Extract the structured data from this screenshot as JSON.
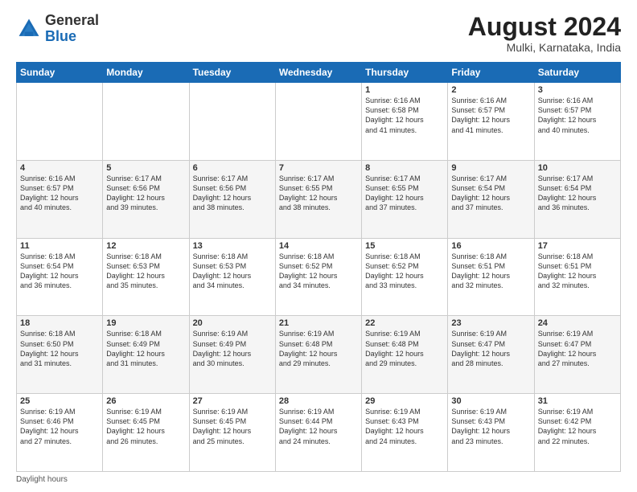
{
  "header": {
    "logo_general": "General",
    "logo_blue": "Blue",
    "title": "August 2024",
    "subtitle": "Mulki, Karnataka, India"
  },
  "days_of_week": [
    "Sunday",
    "Monday",
    "Tuesday",
    "Wednesday",
    "Thursday",
    "Friday",
    "Saturday"
  ],
  "weeks": [
    [
      {
        "day": "",
        "info": ""
      },
      {
        "day": "",
        "info": ""
      },
      {
        "day": "",
        "info": ""
      },
      {
        "day": "",
        "info": ""
      },
      {
        "day": "1",
        "info": "Sunrise: 6:16 AM\nSunset: 6:58 PM\nDaylight: 12 hours\nand 41 minutes."
      },
      {
        "day": "2",
        "info": "Sunrise: 6:16 AM\nSunset: 6:57 PM\nDaylight: 12 hours\nand 41 minutes."
      },
      {
        "day": "3",
        "info": "Sunrise: 6:16 AM\nSunset: 6:57 PM\nDaylight: 12 hours\nand 40 minutes."
      }
    ],
    [
      {
        "day": "4",
        "info": "Sunrise: 6:16 AM\nSunset: 6:57 PM\nDaylight: 12 hours\nand 40 minutes."
      },
      {
        "day": "5",
        "info": "Sunrise: 6:17 AM\nSunset: 6:56 PM\nDaylight: 12 hours\nand 39 minutes."
      },
      {
        "day": "6",
        "info": "Sunrise: 6:17 AM\nSunset: 6:56 PM\nDaylight: 12 hours\nand 38 minutes."
      },
      {
        "day": "7",
        "info": "Sunrise: 6:17 AM\nSunset: 6:55 PM\nDaylight: 12 hours\nand 38 minutes."
      },
      {
        "day": "8",
        "info": "Sunrise: 6:17 AM\nSunset: 6:55 PM\nDaylight: 12 hours\nand 37 minutes."
      },
      {
        "day": "9",
        "info": "Sunrise: 6:17 AM\nSunset: 6:54 PM\nDaylight: 12 hours\nand 37 minutes."
      },
      {
        "day": "10",
        "info": "Sunrise: 6:17 AM\nSunset: 6:54 PM\nDaylight: 12 hours\nand 36 minutes."
      }
    ],
    [
      {
        "day": "11",
        "info": "Sunrise: 6:18 AM\nSunset: 6:54 PM\nDaylight: 12 hours\nand 36 minutes."
      },
      {
        "day": "12",
        "info": "Sunrise: 6:18 AM\nSunset: 6:53 PM\nDaylight: 12 hours\nand 35 minutes."
      },
      {
        "day": "13",
        "info": "Sunrise: 6:18 AM\nSunset: 6:53 PM\nDaylight: 12 hours\nand 34 minutes."
      },
      {
        "day": "14",
        "info": "Sunrise: 6:18 AM\nSunset: 6:52 PM\nDaylight: 12 hours\nand 34 minutes."
      },
      {
        "day": "15",
        "info": "Sunrise: 6:18 AM\nSunset: 6:52 PM\nDaylight: 12 hours\nand 33 minutes."
      },
      {
        "day": "16",
        "info": "Sunrise: 6:18 AM\nSunset: 6:51 PM\nDaylight: 12 hours\nand 32 minutes."
      },
      {
        "day": "17",
        "info": "Sunrise: 6:18 AM\nSunset: 6:51 PM\nDaylight: 12 hours\nand 32 minutes."
      }
    ],
    [
      {
        "day": "18",
        "info": "Sunrise: 6:18 AM\nSunset: 6:50 PM\nDaylight: 12 hours\nand 31 minutes."
      },
      {
        "day": "19",
        "info": "Sunrise: 6:18 AM\nSunset: 6:49 PM\nDaylight: 12 hours\nand 31 minutes."
      },
      {
        "day": "20",
        "info": "Sunrise: 6:19 AM\nSunset: 6:49 PM\nDaylight: 12 hours\nand 30 minutes."
      },
      {
        "day": "21",
        "info": "Sunrise: 6:19 AM\nSunset: 6:48 PM\nDaylight: 12 hours\nand 29 minutes."
      },
      {
        "day": "22",
        "info": "Sunrise: 6:19 AM\nSunset: 6:48 PM\nDaylight: 12 hours\nand 29 minutes."
      },
      {
        "day": "23",
        "info": "Sunrise: 6:19 AM\nSunset: 6:47 PM\nDaylight: 12 hours\nand 28 minutes."
      },
      {
        "day": "24",
        "info": "Sunrise: 6:19 AM\nSunset: 6:47 PM\nDaylight: 12 hours\nand 27 minutes."
      }
    ],
    [
      {
        "day": "25",
        "info": "Sunrise: 6:19 AM\nSunset: 6:46 PM\nDaylight: 12 hours\nand 27 minutes."
      },
      {
        "day": "26",
        "info": "Sunrise: 6:19 AM\nSunset: 6:45 PM\nDaylight: 12 hours\nand 26 minutes."
      },
      {
        "day": "27",
        "info": "Sunrise: 6:19 AM\nSunset: 6:45 PM\nDaylight: 12 hours\nand 25 minutes."
      },
      {
        "day": "28",
        "info": "Sunrise: 6:19 AM\nSunset: 6:44 PM\nDaylight: 12 hours\nand 24 minutes."
      },
      {
        "day": "29",
        "info": "Sunrise: 6:19 AM\nSunset: 6:43 PM\nDaylight: 12 hours\nand 24 minutes."
      },
      {
        "day": "30",
        "info": "Sunrise: 6:19 AM\nSunset: 6:43 PM\nDaylight: 12 hours\nand 23 minutes."
      },
      {
        "day": "31",
        "info": "Sunrise: 6:19 AM\nSunset: 6:42 PM\nDaylight: 12 hours\nand 22 minutes."
      }
    ]
  ],
  "footer": "Daylight hours"
}
